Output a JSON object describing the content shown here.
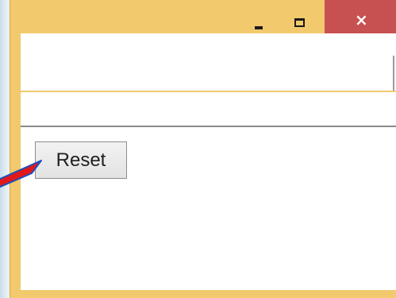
{
  "window": {
    "controls": {
      "minimize_icon": "minimize-icon",
      "maximize_icon": "maximize-icon",
      "close_icon": "close-icon",
      "close_glyph": "×"
    },
    "text_field": {
      "value": "",
      "placeholder": ""
    },
    "reset_button": {
      "label": "Reset"
    }
  },
  "colors": {
    "window_frame": "#f2c96d",
    "close_button": "#c75050",
    "client_background": "#ffffff",
    "pointer_arrow": "#e0191b",
    "pointer_arrow_outline": "#1f4fb8"
  }
}
